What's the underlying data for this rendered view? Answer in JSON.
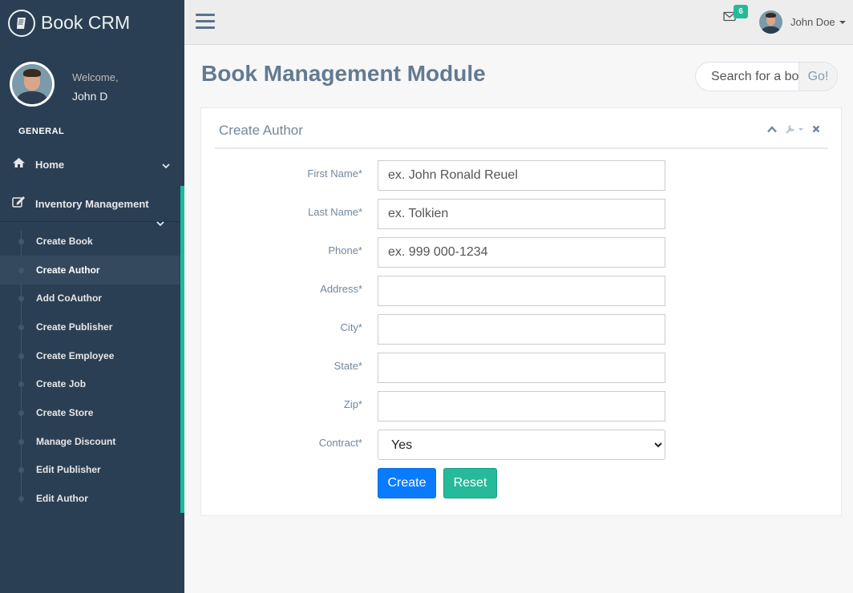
{
  "brand": {
    "name": "Book CRM",
    "icon": "book-icon"
  },
  "profile": {
    "welcome": "Welcome,",
    "name": "John D"
  },
  "sidebar": {
    "section": "GENERAL",
    "home_label": "Home",
    "inventory_label": "Inventory Management",
    "items": [
      {
        "label": "Create Book"
      },
      {
        "label": "Create Author",
        "active": true
      },
      {
        "label": "Add CoAuthor"
      },
      {
        "label": "Create Publisher"
      },
      {
        "label": "Create Employee"
      },
      {
        "label": "Create Job"
      },
      {
        "label": "Create Store"
      },
      {
        "label": "Manage Discount"
      },
      {
        "label": "Edit Publisher"
      },
      {
        "label": "Edit Author"
      }
    ]
  },
  "topnav": {
    "mail_count": "6",
    "user_name": "John Doe"
  },
  "page": {
    "title": "Book Management Module"
  },
  "search": {
    "placeholder": "Search for a book...",
    "button": "Go!"
  },
  "panel": {
    "title": "Create Author"
  },
  "form": {
    "first_name": {
      "label": "First Name*",
      "placeholder": "ex. John Ronald Reuel"
    },
    "last_name": {
      "label": "Last Name*",
      "placeholder": "ex. Tolkien"
    },
    "phone": {
      "label": "Phone*",
      "placeholder": "ex. 999 000-1234"
    },
    "address": {
      "label": "Address*",
      "placeholder": ""
    },
    "city": {
      "label": "City*",
      "placeholder": ""
    },
    "state": {
      "label": "State*",
      "placeholder": ""
    },
    "zip": {
      "label": "Zip*",
      "placeholder": ""
    },
    "contract": {
      "label": "Contract*",
      "selected": "Yes"
    },
    "create_button": "Create",
    "reset_button": "Reset"
  },
  "colors": {
    "sidebar": "#2A3F54",
    "accent": "#1ABB9C",
    "primary": "#0A7BFF",
    "success": "#26B99A"
  }
}
